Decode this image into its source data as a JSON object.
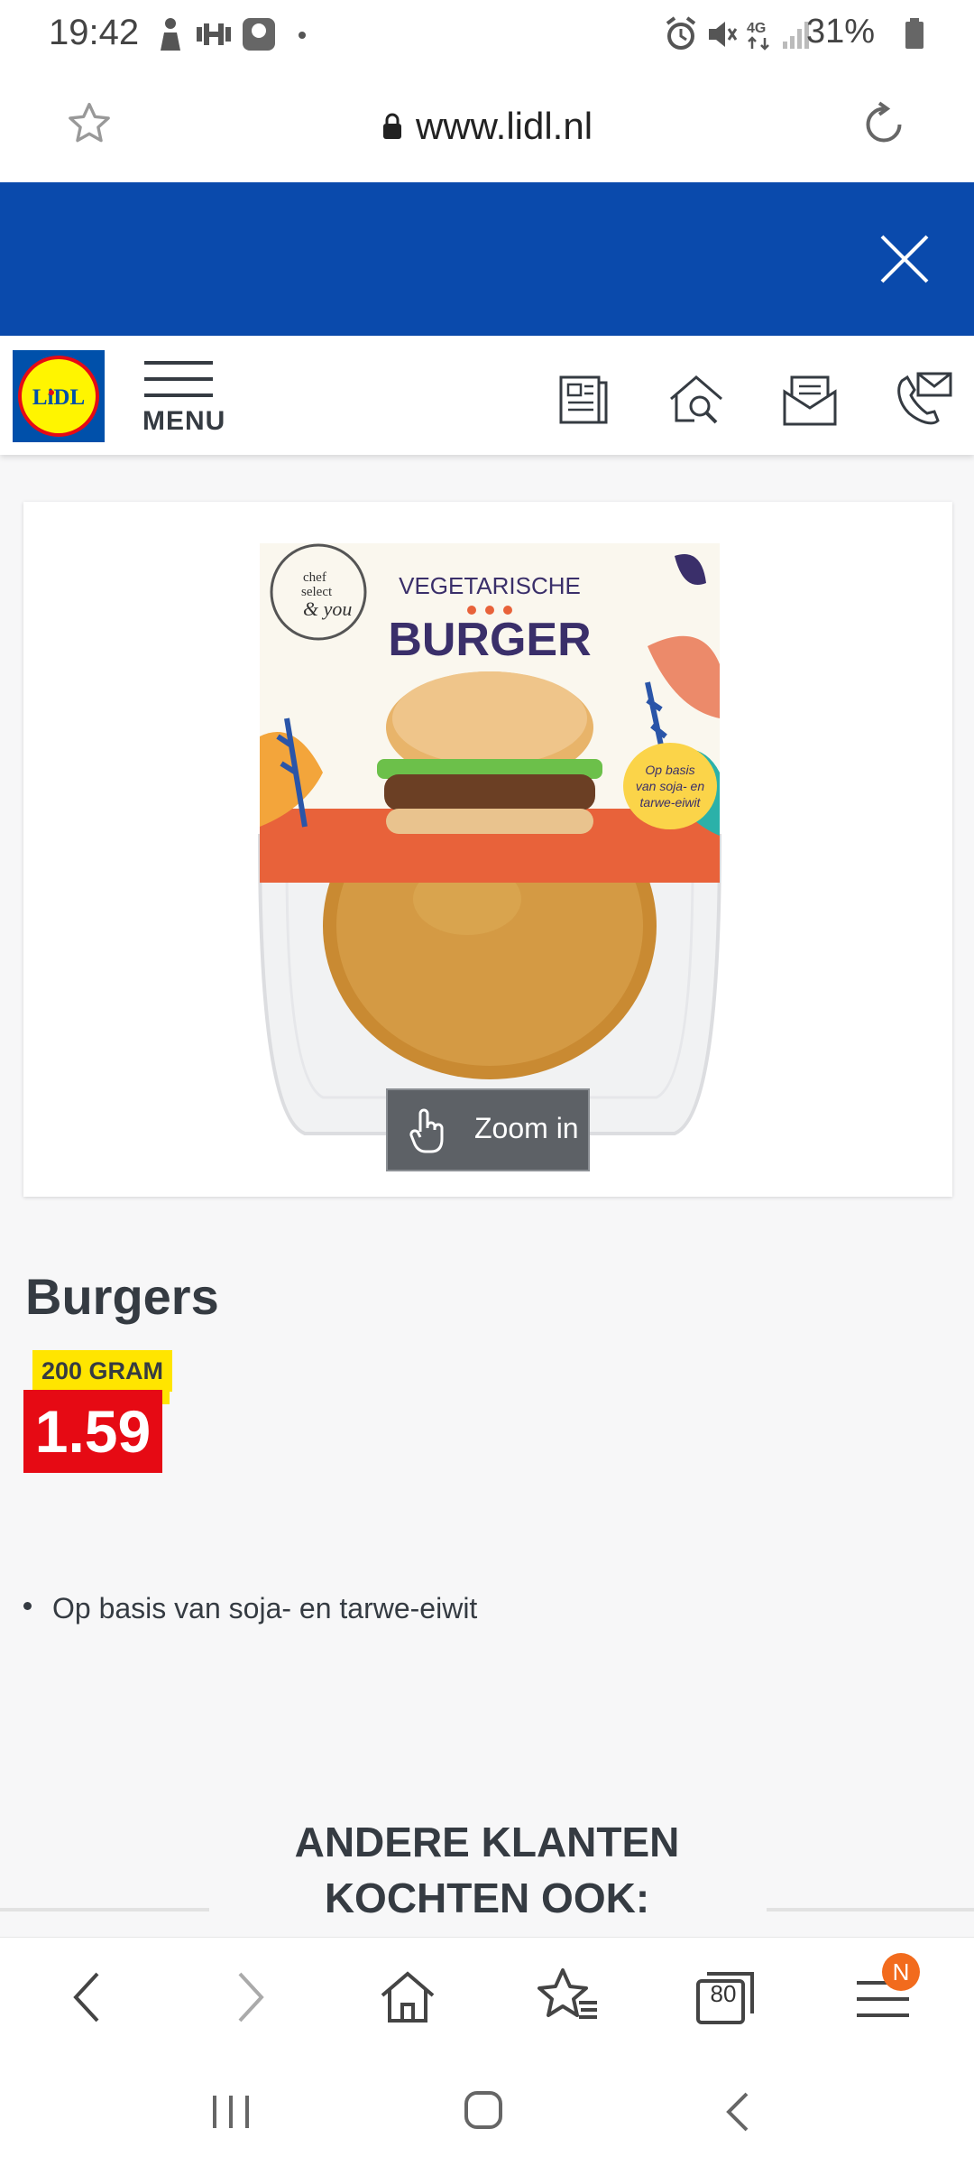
{
  "status_bar": {
    "time": "19:42",
    "battery": "31%"
  },
  "url_bar": {
    "url": "www.lidl.nl",
    "icons": [
      "star-icon",
      "lock-icon",
      "reload-icon"
    ]
  },
  "banner": {
    "close_icon": "close-icon",
    "color": "#0a4aac"
  },
  "header": {
    "logo_text": "LiDL",
    "menu_label": "MENU",
    "icons": [
      "leaflet-icon",
      "store-search-icon",
      "newsletter-icon",
      "contact-icon"
    ]
  },
  "product": {
    "zoom_label": "Zoom in",
    "title": "Burgers",
    "weight": "200 GRAM",
    "price": "1.59",
    "bullets": [
      "Op basis van soja- en tarwe-eiwit"
    ],
    "package_text": {
      "brand_lines": [
        "chef",
        "select",
        "& you"
      ],
      "line1": "VEGETARISCHE",
      "line2": "BURGER",
      "side_lines": [
        "Op basis",
        "van soja- en",
        "tarwe-eiwit"
      ]
    }
  },
  "section": {
    "title_line1": "ANDERE KLANTEN",
    "title_line2": "KOCHTEN OOK:"
  },
  "toolbar": {
    "tabs_count": "80",
    "notification": "N",
    "icons": [
      "back-icon",
      "forward-icon",
      "home-icon",
      "bookmarks-icon",
      "tabs-icon",
      "menu-icon"
    ]
  },
  "colors": {
    "lidl_blue": "#0050aa",
    "lidl_red": "#e60a14",
    "lidl_yellow": "#ffe500",
    "text": "#353b42"
  }
}
